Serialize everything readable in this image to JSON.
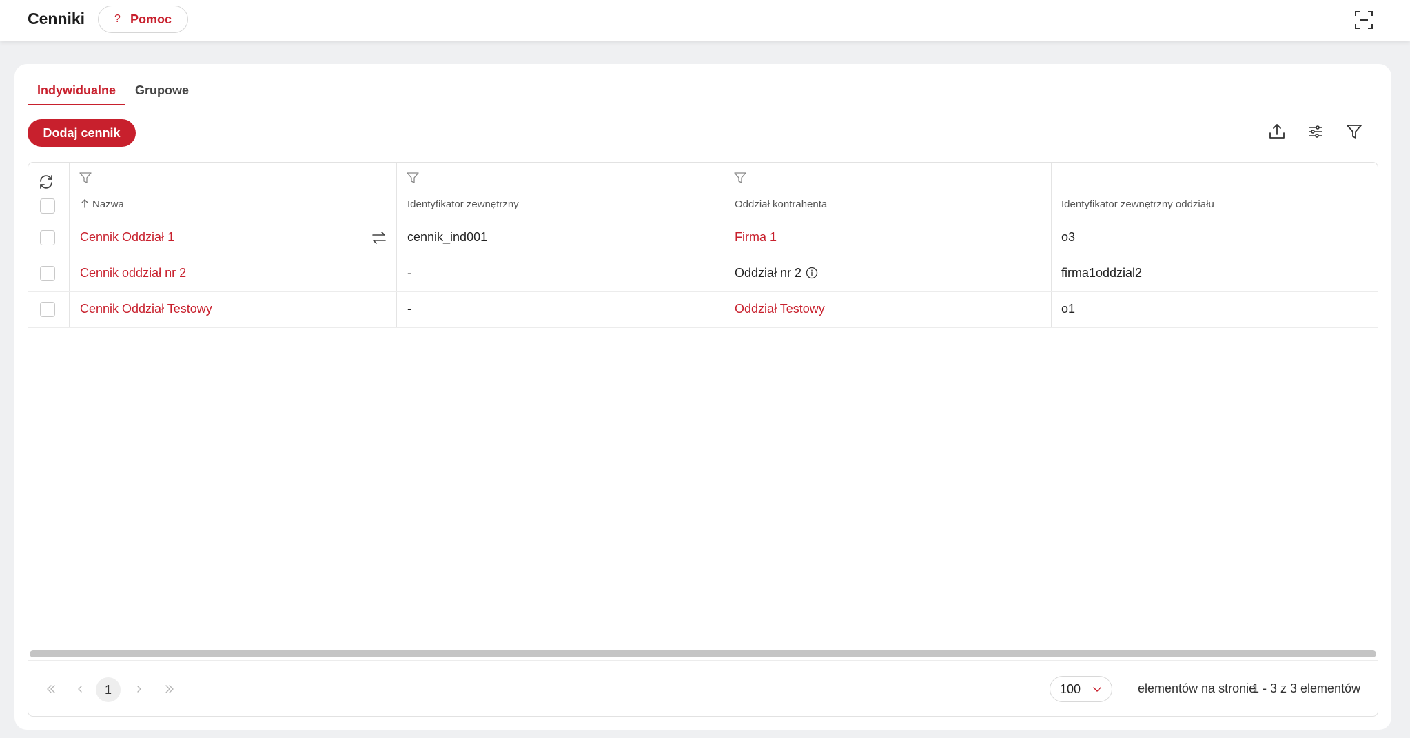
{
  "header": {
    "title": "Cenniki",
    "help": {
      "icon": "?",
      "label": "Pomoc"
    },
    "fullscreen_icon": "fullscreen-icon"
  },
  "tabs": [
    {
      "label": "Indywidualne",
      "active": true
    },
    {
      "label": "Grupowe",
      "active": false
    }
  ],
  "toolbar": {
    "add_label": "Dodaj cennik",
    "icons": [
      "export-icon",
      "settings-sliders-icon",
      "filter-icon"
    ]
  },
  "table": {
    "columns": [
      {
        "label": "Nazwa",
        "sort": "asc",
        "filterable": true
      },
      {
        "label": "Identyfikator zewnętrzny",
        "filterable": true
      },
      {
        "label": "Oddział kontrahenta",
        "filterable": true
      },
      {
        "label": "Identyfikator zewnętrzny oddziału",
        "filterable": false
      }
    ],
    "rows": [
      {
        "name": "Cennik Oddział 1",
        "external_id": "cennik_ind001",
        "branch": "Firma 1",
        "branch_is_link": true,
        "branch_external_id": "o3",
        "has_swap_icon": true,
        "has_info_icon": false
      },
      {
        "name": "Cennik oddział nr 2",
        "external_id": "-",
        "branch": "Oddział nr 2",
        "branch_is_link": false,
        "branch_external_id": "firma1oddzial2",
        "has_swap_icon": false,
        "has_info_icon": true
      },
      {
        "name": "Cennik Oddział Testowy",
        "external_id": "-",
        "branch": "Oddział Testowy",
        "branch_is_link": true,
        "branch_external_id": "o1",
        "has_swap_icon": false,
        "has_info_icon": false
      }
    ]
  },
  "pagination": {
    "current_page": "1",
    "page_size": "100",
    "per_page_label": "elementów na stronie",
    "range_label": "1 - 3 z 3 elementów"
  },
  "colors": {
    "accent": "#c8202d",
    "background": "#eff0f2"
  }
}
